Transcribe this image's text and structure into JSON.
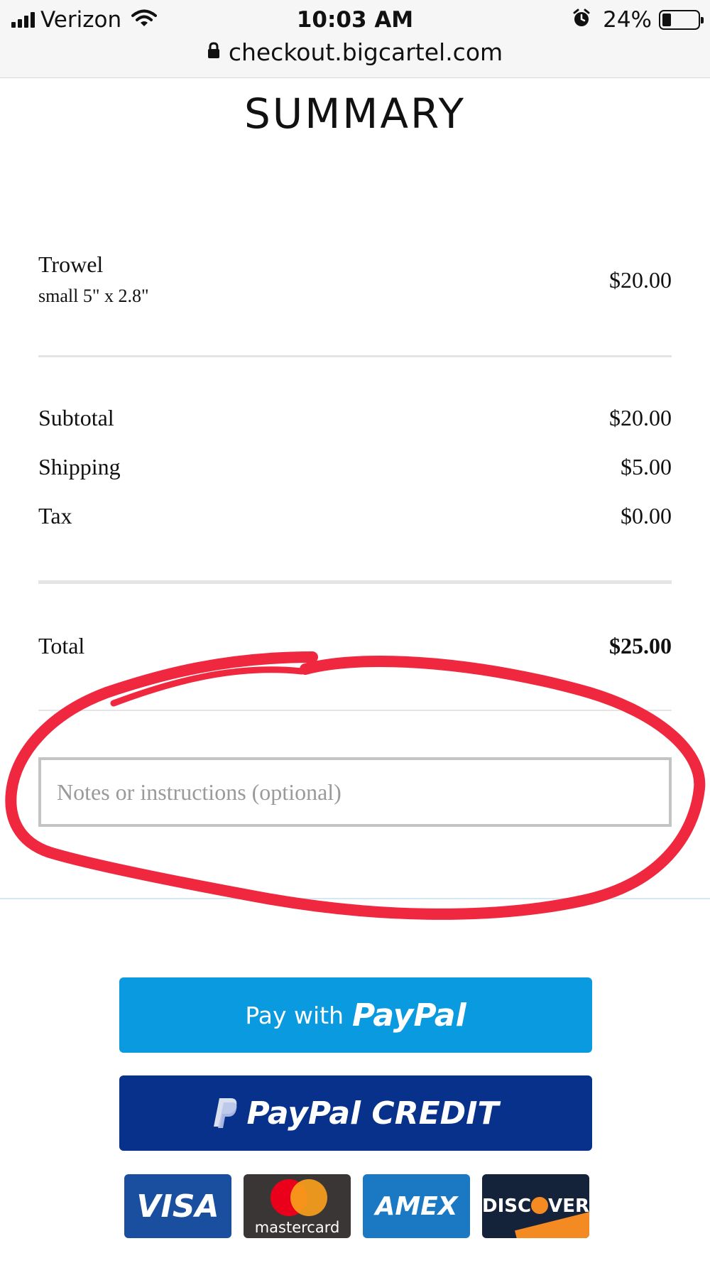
{
  "status_bar": {
    "carrier": "Verizon",
    "time": "10:03 AM",
    "battery_percent": "24%",
    "battery_level": 0.24,
    "url": "checkout.bigcartel.com",
    "icons": [
      "signal-icon",
      "wifi-icon",
      "alarm-icon",
      "battery-icon",
      "lock-icon"
    ]
  },
  "summary": {
    "title": "SUMMARY",
    "item": {
      "name": "Trowel",
      "option": "small 5\" x 2.8\"",
      "price": "$20.00"
    },
    "subtotal_label": "Subtotal",
    "subtotal_value": "$20.00",
    "shipping_label": "Shipping",
    "shipping_value": "$5.00",
    "tax_label": "Tax",
    "tax_value": "$0.00",
    "total_label": "Total",
    "total_value": "$25.00"
  },
  "notes": {
    "placeholder": "Notes or instructions (optional)",
    "value": ""
  },
  "payment": {
    "paypal_prefix": "Pay with",
    "paypal_brand": "PayPal",
    "credit_brand": "PayPal CREDIT",
    "credit_mark": "P",
    "cards": {
      "visa": "VISA",
      "mastercard": "mastercard",
      "amex": "AMEX",
      "discover_pre": "DISC",
      "discover_post": "VER"
    }
  },
  "colors": {
    "annotation": "#f0283f",
    "paypal_blue": "#0a9ae0",
    "paypal_credit_navy": "#07318a"
  }
}
